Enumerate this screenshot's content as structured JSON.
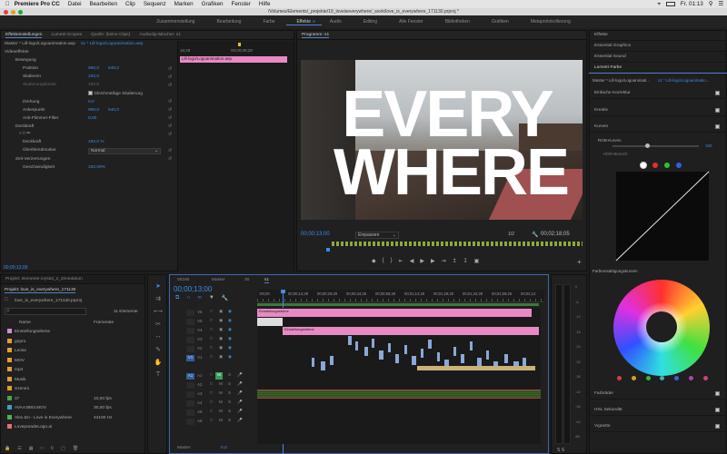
{
  "menubar": {
    "app": "Premiere Pro CC",
    "items": [
      "Datei",
      "Bearbeiten",
      "Clip",
      "Sequenz",
      "Marken",
      "Grafiken",
      "Fenster",
      "Hilfe"
    ],
    "clock": "Fr. 01:13"
  },
  "title": "/Volumes/Elements/_projekte/19_loveiseverywhere/_work/love_is_everywhere_171130.prproj *",
  "workspaces": [
    "Zusammenstellung",
    "Bearbeitung",
    "Farbe",
    "Effekte",
    "Audio",
    "Editing",
    "Alle Fenster",
    "Bibliotheken",
    "Grafiken",
    "Metaprotokollierung"
  ],
  "active_workspace": "Effekte",
  "effect_panel": {
    "tabs": [
      "Effekteinstellungen",
      "Lumetri-Scopes",
      "Quelle: (keine Clips)",
      "Audioclip-Mischer: s1"
    ],
    "master": "Master * Lill-logo/Logoanimation.aep",
    "seq": "s1 * Lill-logo/Logoanimation.aep",
    "section": "Videoeffekte",
    "ruler_start": "16;29",
    "ruler_end": "00;00;09;29",
    "clip_label": "Lill-logo/Logoanimation.aep",
    "rows": {
      "fx": "Bewegung",
      "position": "Position",
      "position_x": "960,0",
      "position_y": "540,0",
      "scale": "Skalieren",
      "scale_val": "100,0",
      "scale_w": "Skalierungsbreite",
      "scale_w_val": "100,0",
      "uniform": "Gleichmäßige Skalierung",
      "rotation": "Drehung",
      "rotation_val": "0,0",
      "anchor": "Ankerpunkt",
      "anchor_x": "960,0",
      "anchor_y": "540,0",
      "flicker": "Anti-Flimmer-Filter",
      "flicker_val": "0,00",
      "opacity_fx": "Deckkraft",
      "opacity": "Deckkraft",
      "opacity_val": "100,0 %",
      "blend": "Überblendmodus",
      "blend_val": "Normal",
      "time_remap": "Zeit-Verzerrungen",
      "speed": "Geschwindigkeit",
      "speed_val": "100,00%"
    },
    "timecode": "00;00;13;00"
  },
  "program": {
    "tab": "Programm: s1",
    "text1": "EVERY",
    "text2": "WHERE",
    "timecode": "00;00;13;00",
    "fit": "Einpassen",
    "ratio": "1/2",
    "duration": "00;02;18;05"
  },
  "lumetri": {
    "items": [
      "Effekte",
      "Essential Graphics",
      "Essential Sound",
      "Lumetri-Farbe"
    ],
    "master": "Master * Lill-logo/Logoanimati...",
    "seq": "s1 * Lill-logo/Logoanimatio...",
    "rows": [
      "Einfache Korrektur",
      "Kreativ",
      "Kurven"
    ],
    "rgb": "RGB-Kurven",
    "rgb_val": "100",
    "hdr": "HDR-Bereich",
    "hsl": "Farbtonsättigungskurven",
    "bottom": [
      "Farbräder",
      "HSL Sekundär",
      "Vignette"
    ],
    "dot_colors": [
      "#ffffff",
      "#e03030",
      "#30c030",
      "#3060e0"
    ],
    "wheel_dots": [
      "#d04040",
      "#d0a030",
      "#40b040",
      "#40b0b0",
      "#4060d0",
      "#b040b0",
      "#d04080"
    ]
  },
  "project": {
    "tab": "Projekt: elemente-crystal_2_ohnedatum",
    "subtab": "Projekt: love_is_everywhere_171130",
    "file": "love_is_everywhere_171130.prproj",
    "count": "11 Elemente",
    "col_name": "Name",
    "col_fr": "Framerate",
    "items": [
      {
        "name": "Einstellungsebene",
        "fr": "",
        "color": "#d090d0"
      },
      {
        "name": "gopro",
        "fr": "",
        "color": "#e0a030"
      },
      {
        "name": "Lense",
        "fr": "",
        "color": "#e0a030"
      },
      {
        "name": "MOV",
        "fr": "",
        "color": "#e0a030"
      },
      {
        "name": "mp4",
        "fr": "",
        "color": "#e0a030"
      },
      {
        "name": "Musik",
        "fr": "",
        "color": "#e0a030"
      },
      {
        "name": "Szene1",
        "fr": "",
        "color": "#e0a030"
      },
      {
        "name": "37",
        "fr": "10,00 fps",
        "color": "#50a050"
      },
      {
        "name": "AVAA3893.MOV",
        "fr": "30,00 fps",
        "color": "#40a0c0"
      },
      {
        "name": "Alex.Do - Love is Everywhere",
        "fr": "44100 Hz",
        "color": "#50b050"
      },
      {
        "name": "LoveparadeLogo.ai",
        "fr": "",
        "color": "#e07070"
      }
    ]
  },
  "timeline": {
    "tabs": [
      "00160",
      "Master",
      "30",
      "s1"
    ],
    "timecode": "00;00;13;00",
    "ruler": [
      ":00;00",
      "00;00;14;29",
      "00;00;29;29",
      "00;00;44;28",
      "00;00;59;28",
      "00;01;14;28",
      "00;01;29;28",
      "00;01;44;28",
      "00;01;59;28",
      "00;02;14"
    ],
    "tracks": [
      "V6",
      "V5",
      "V4",
      "V3",
      "V2",
      "V1",
      "A1",
      "A2",
      "A3",
      "A4",
      "A5",
      "A6"
    ],
    "master": "Master",
    "master_val": "0,0",
    "clip_v5": "Einstellungsebene",
    "clip_v3": "Einstellungsebene"
  },
  "meter_ticks": [
    "0",
    "-6",
    "-12",
    "-18",
    "-24",
    "-30",
    "-36",
    "-42",
    "-48",
    "-54",
    "dB"
  ]
}
